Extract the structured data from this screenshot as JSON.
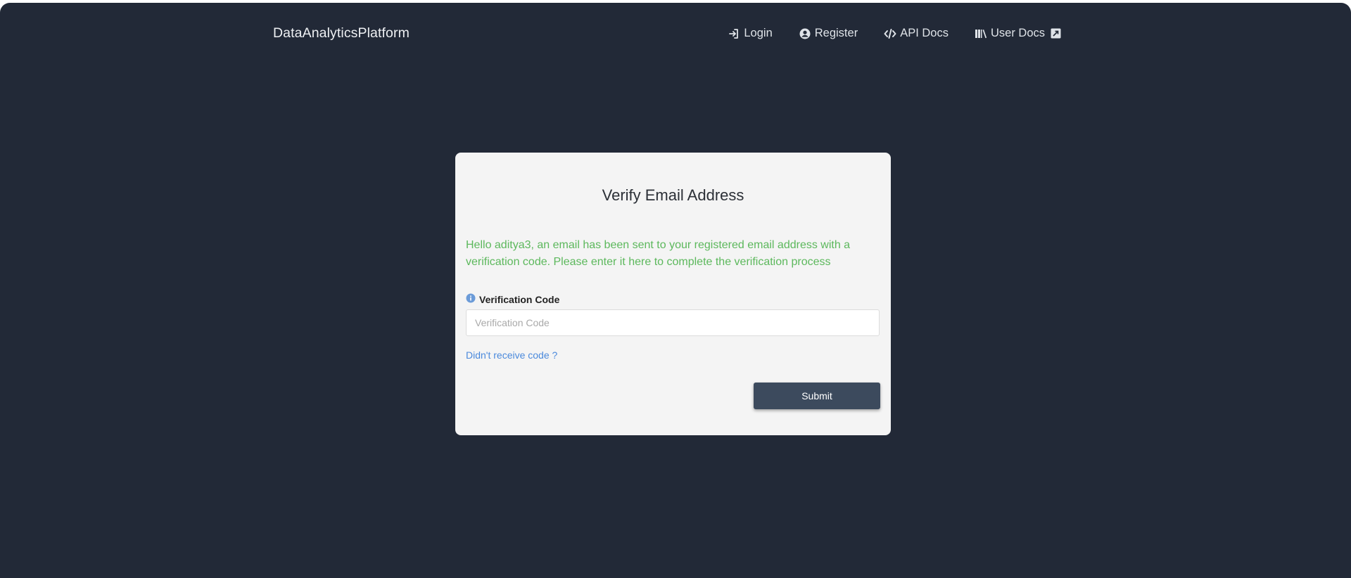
{
  "navbar": {
    "brand": "DataAnalyticsPlatform",
    "items": [
      {
        "label": "Login",
        "icon": "login-icon"
      },
      {
        "label": "Register",
        "icon": "user-circle-icon"
      },
      {
        "label": "API Docs",
        "icon": "code-icon"
      },
      {
        "label": "User Docs",
        "icon": "books-icon",
        "trailing_icon": "external-link-icon"
      }
    ]
  },
  "card": {
    "title": "Verify Email Address",
    "message": "Hello aditya3, an email has been sent to your registered email address with a verification code. Please enter it here to complete the verification process",
    "field": {
      "label": "Verification Code",
      "placeholder": "Verification Code",
      "value": "",
      "icon": "info-icon"
    },
    "resend_link": "Didn't receive code ?",
    "submit_label": "Submit"
  },
  "colors": {
    "background": "#222937",
    "card": "#f4f4f4",
    "success_text": "#5cb85c",
    "link": "#4a89dc",
    "button": "#3c4a5d"
  }
}
